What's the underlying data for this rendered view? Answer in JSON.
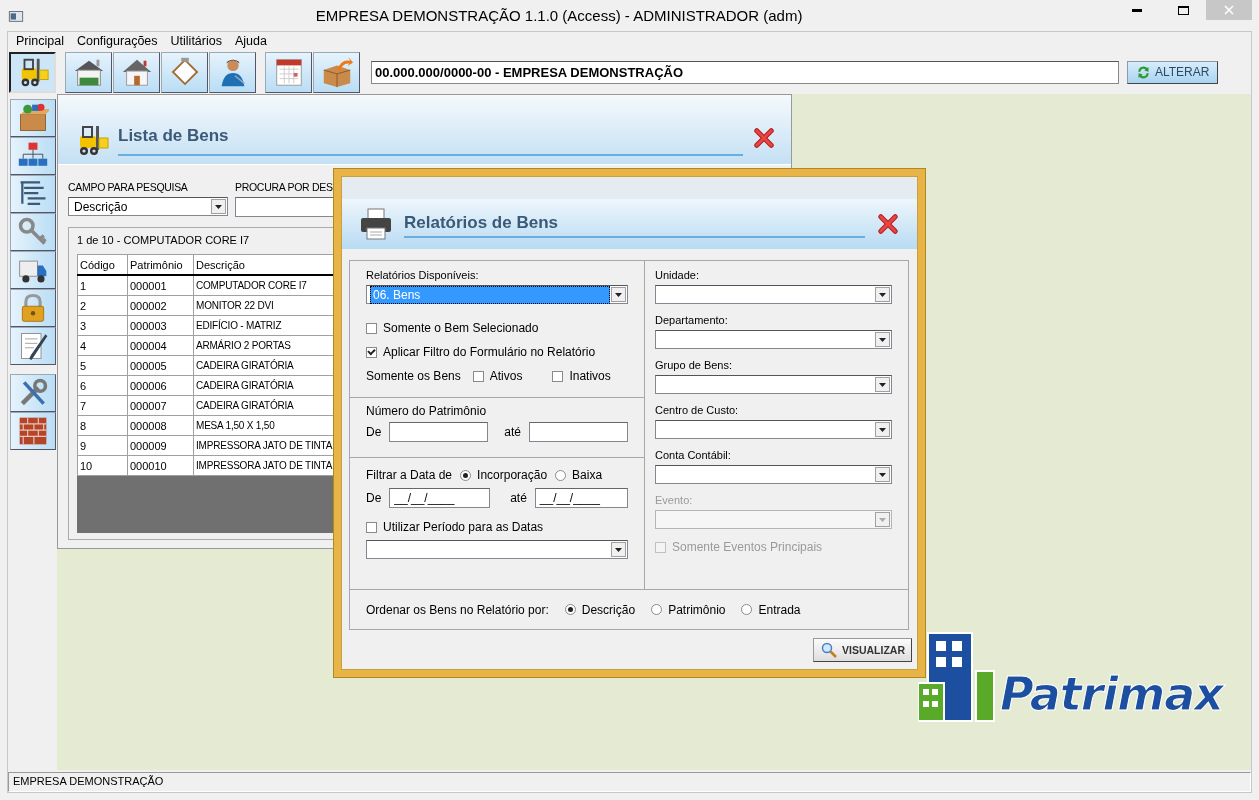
{
  "window": {
    "title": "EMPRESA DEMONSTRAÇÃO 1.1.0 (Access) - ADMINISTRADOR (adm)"
  },
  "menu": [
    {
      "label": "Principal"
    },
    {
      "label": "Configurações"
    },
    {
      "label": "Utilitários"
    },
    {
      "label": "Ajuda"
    }
  ],
  "toolbar": {
    "groups": [
      [
        {
          "kind": "forklift",
          "selected": true
        }
      ],
      [
        {
          "kind": "warehouse",
          "selected": false
        },
        {
          "kind": "house",
          "selected": false
        },
        {
          "kind": "clipboard",
          "selected": false
        },
        {
          "kind": "user",
          "selected": false
        }
      ],
      [
        {
          "kind": "calendar",
          "selected": false
        },
        {
          "kind": "box",
          "selected": false
        }
      ]
    ],
    "company_field": {
      "value": "00.000.000/0000-00 - EMPRESA DEMONSTRAÇÃO"
    },
    "alter_button": {
      "label": "ALTERAR"
    }
  },
  "sidebar": {
    "groups": [
      [
        {
          "kind": "boxes"
        },
        {
          "kind": "org-chart"
        },
        {
          "kind": "tree"
        },
        {
          "kind": "key"
        },
        {
          "kind": "truck"
        },
        {
          "kind": "lock"
        },
        {
          "kind": "document"
        }
      ],
      [
        {
          "kind": "tools"
        },
        {
          "kind": "wall"
        }
      ]
    ]
  },
  "list_window": {
    "title": "Lista de Bens",
    "search_field_label": "CAMPO PARA PESQUISA",
    "search_field_value": "Descrição",
    "search_text_label": "PROCURA POR DES",
    "record_caption": "1 de 10 - COMPUTADOR CORE I7",
    "table": {
      "columns": [
        "Código",
        "Patrimônio",
        "Descrição"
      ],
      "rows": [
        [
          "1",
          "000001",
          "COMPUTADOR CORE I7"
        ],
        [
          "2",
          "000002",
          "MONITOR 22 DVI"
        ],
        [
          "3",
          "000003",
          "EDIFÍCIO - MATRIZ"
        ],
        [
          "4",
          "000004",
          "ARMÁRIO 2 PORTAS"
        ],
        [
          "5",
          "000005",
          "CADEIRA GIRATÓRIA"
        ],
        [
          "6",
          "000006",
          "CADEIRA GIRATÓRIA"
        ],
        [
          "7",
          "000007",
          "CADEIRA GIRATÓRIA"
        ],
        [
          "8",
          "000008",
          "MESA 1,50 X 1,50"
        ],
        [
          "9",
          "000009",
          "IMPRESSORA JATO DE TINTA"
        ],
        [
          "10",
          "000010",
          "IMPRESSORA JATO DE TINTA"
        ]
      ]
    }
  },
  "report_dialog": {
    "title": "Relatórios de Bens",
    "reports_label": "Relatórios Disponíveis:",
    "reports_combo": {
      "value": "06. Bens",
      "focused": true
    },
    "options": [
      {
        "label": "Somente o Bem Selecionado",
        "checked": false
      },
      {
        "label": "Aplicar Filtro do Formulário no Relatório",
        "checked": true
      }
    ],
    "status_filter": {
      "label": "Somente os Bens",
      "options": [
        {
          "label": "Ativos",
          "checked": false
        },
        {
          "label": "Inativos",
          "checked": false
        }
      ]
    },
    "asset_number": {
      "title": "Número do Patrimônio",
      "from_label": "De",
      "to_label": "até"
    },
    "date_filter": {
      "label": "Filtrar a Data de",
      "options": [
        {
          "label": "Incorporação",
          "selected": true
        },
        {
          "label": "Baixa",
          "selected": false
        }
      ],
      "from_label": "De",
      "from_value": "__/__/____",
      "to_label": "até",
      "to_value": "__/__/____"
    },
    "period": {
      "label": "Utilizar Período para as Datas",
      "checked": false
    },
    "filters": [
      {
        "label": "Unidade:",
        "disabled": false
      },
      {
        "label": "Departamento:",
        "disabled": false
      },
      {
        "label": "Grupo de Bens:",
        "disabled": false
      },
      {
        "label": "Centro de Custo:",
        "disabled": false
      },
      {
        "label": "Conta Contábil:",
        "disabled": false
      },
      {
        "label": "Evento:",
        "disabled": true
      }
    ],
    "main_events": {
      "label": "Somente Eventos Principais",
      "checked": false,
      "disabled": true
    },
    "sort": {
      "label": "Ordenar os Bens no Relatório por:",
      "options": [
        {
          "label": "Descrição",
          "selected": true
        },
        {
          "label": "Patrimônio",
          "selected": false
        },
        {
          "label": "Entrada",
          "selected": false
        }
      ]
    },
    "view_button": {
      "label": "VISUALIZAR"
    }
  },
  "logo": {
    "text": "Patrimax"
  },
  "status_bar": {
    "text": "EMPRESA DEMONSTRAÇÃO"
  }
}
